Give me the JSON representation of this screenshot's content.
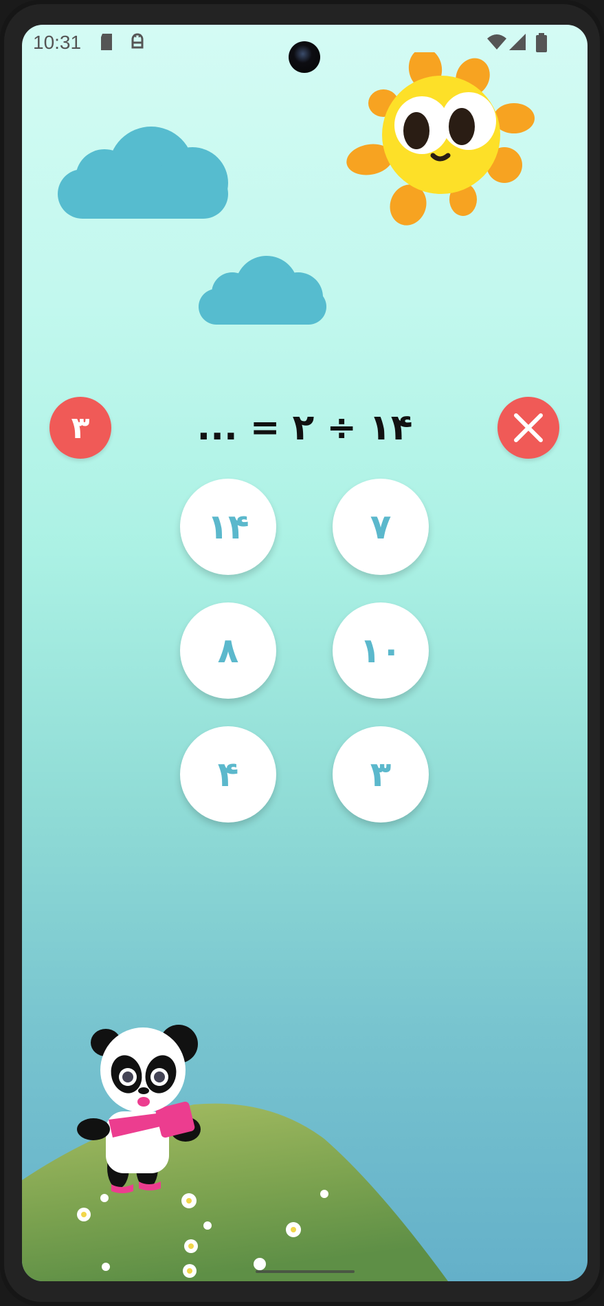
{
  "status_bar": {
    "time": "10:31",
    "icons": [
      "sd-card-icon",
      "android-debug-icon",
      "wifi-icon",
      "cellular-signal-icon",
      "battery-icon"
    ]
  },
  "game": {
    "lives": "۳",
    "question": "۱۴ ÷ ۲ = ...",
    "answers": [
      "۷",
      "۱۴",
      "۱۰",
      "۸",
      "۳",
      "۴"
    ]
  },
  "colors": {
    "sky_top": "#d4fbf4",
    "sky_bottom": "#64b0c9",
    "accent_red": "#f05a57",
    "answer_text": "#5bb8cc",
    "cloud": "#56bccf",
    "sun": "#fde028",
    "sun_rays": "#f7a321",
    "hill": "#7ba24f"
  },
  "decorations": [
    "sun-character",
    "cloud",
    "cloud",
    "hill",
    "panda-character"
  ]
}
